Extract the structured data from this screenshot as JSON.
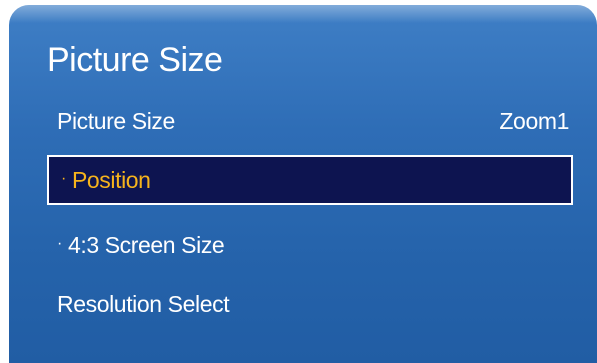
{
  "menu": {
    "title": "Picture Size",
    "items": [
      {
        "label": "Picture Size",
        "value": "Zoom1"
      },
      {
        "bullet": "·",
        "label": "Position",
        "selected": true
      },
      {
        "bullet": "·",
        "label": "4:3 Screen Size"
      },
      {
        "label": "Resolution Select"
      }
    ]
  },
  "colors": {
    "panel_background": "#2e6db6",
    "selected_background": "#0d1450",
    "selected_text": "#f6b41c",
    "text": "#ffffff"
  }
}
